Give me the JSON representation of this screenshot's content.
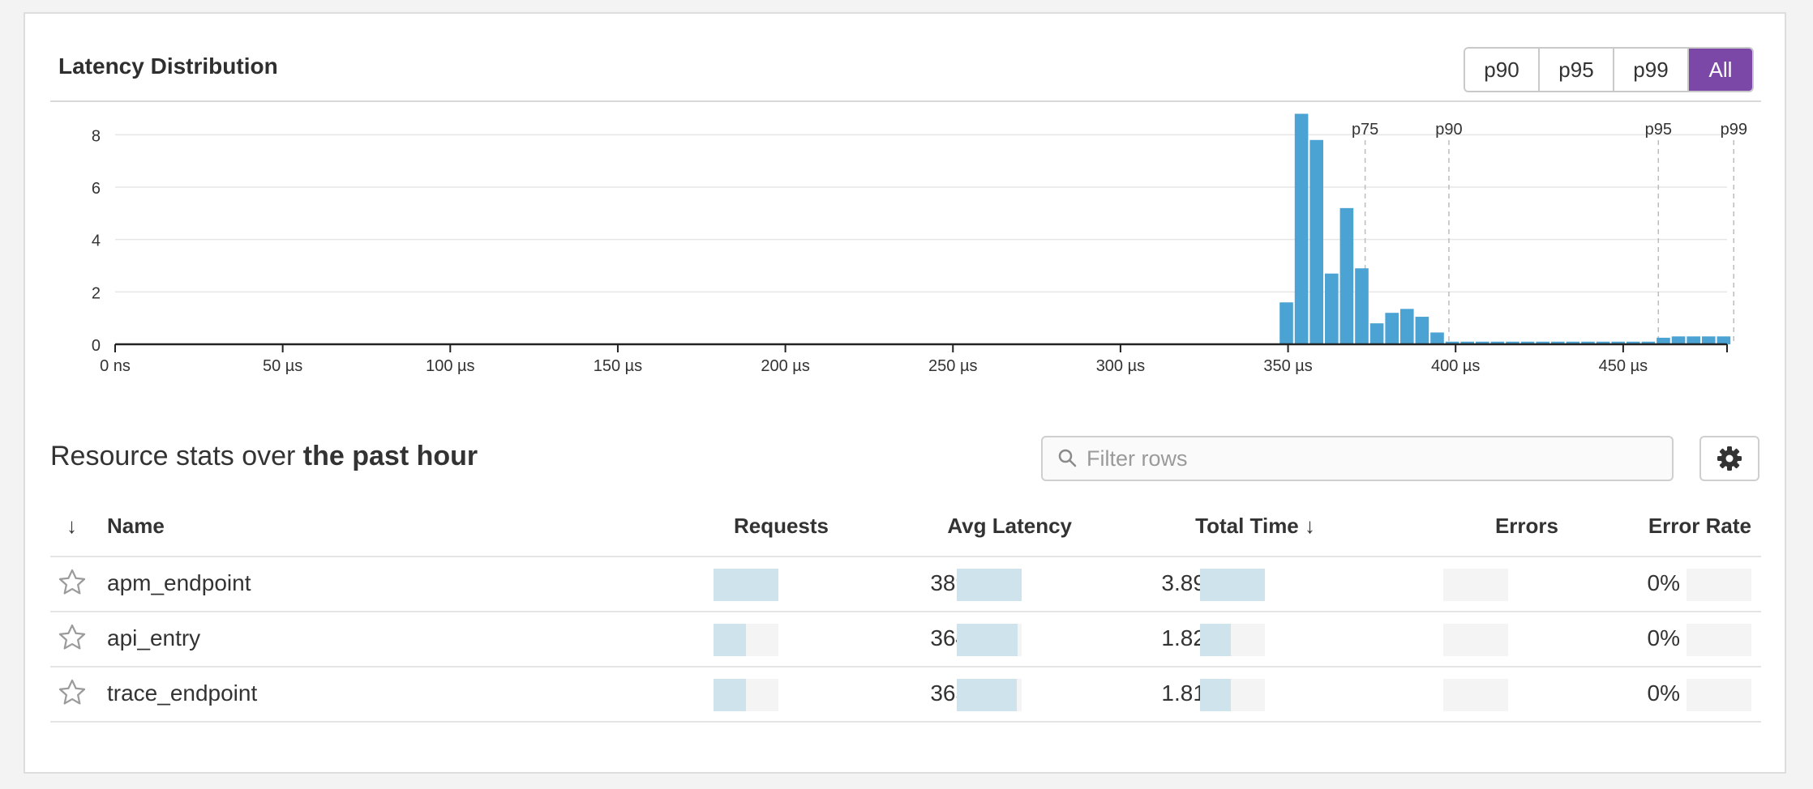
{
  "latency": {
    "title": "Latency Distribution",
    "percentile_buttons": [
      "p90",
      "p95",
      "p99",
      "All"
    ],
    "active_button": "All"
  },
  "chart_data": {
    "type": "bar",
    "title": "",
    "x_ticks": [
      "0 ns",
      "50 µs",
      "100 µs",
      "150 µs",
      "200 µs",
      "250 µs",
      "300 µs",
      "350 µs",
      "400 µs",
      "450 µs"
    ],
    "x_tick_values": [
      0,
      50,
      100,
      150,
      200,
      250,
      300,
      350,
      400,
      450
    ],
    "xlim": [
      0,
      481
    ],
    "y_ticks": [
      0,
      2,
      4,
      6,
      8
    ],
    "ylim": [
      0,
      9
    ],
    "grid": true,
    "bar_color": "#4aa3d3",
    "bins": [
      {
        "x": 349.5,
        "y": 1.6
      },
      {
        "x": 354.0,
        "y": 8.8
      },
      {
        "x": 358.5,
        "y": 7.8
      },
      {
        "x": 363.0,
        "y": 2.7
      },
      {
        "x": 367.5,
        "y": 5.2
      },
      {
        "x": 372.0,
        "y": 2.9
      },
      {
        "x": 376.5,
        "y": 0.8
      },
      {
        "x": 381.0,
        "y": 1.2
      },
      {
        "x": 385.5,
        "y": 1.35
      },
      {
        "x": 390.0,
        "y": 1.05
      },
      {
        "x": 394.5,
        "y": 0.45
      },
      {
        "x": 399.0,
        "y": 0.1
      },
      {
        "x": 403.5,
        "y": 0.1
      },
      {
        "x": 408.0,
        "y": 0.1
      },
      {
        "x": 412.5,
        "y": 0.1
      },
      {
        "x": 417.0,
        "y": 0.1
      },
      {
        "x": 421.5,
        "y": 0.1
      },
      {
        "x": 426.0,
        "y": 0.1
      },
      {
        "x": 430.5,
        "y": 0.1
      },
      {
        "x": 435.0,
        "y": 0.1
      },
      {
        "x": 439.5,
        "y": 0.1
      },
      {
        "x": 444.0,
        "y": 0.1
      },
      {
        "x": 448.5,
        "y": 0.1
      },
      {
        "x": 453.0,
        "y": 0.1
      },
      {
        "x": 457.5,
        "y": 0.1
      },
      {
        "x": 462.0,
        "y": 0.25
      },
      {
        "x": 466.5,
        "y": 0.3
      },
      {
        "x": 471.0,
        "y": 0.3
      },
      {
        "x": 475.5,
        "y": 0.3
      },
      {
        "x": 480.0,
        "y": 0.3
      }
    ],
    "bin_width": 4.5,
    "percentile_markers": [
      {
        "label": "p75",
        "x": 373
      },
      {
        "label": "p90",
        "x": 398
      },
      {
        "label": "p95",
        "x": 460.5
      },
      {
        "label": "p99",
        "x": 483
      }
    ]
  },
  "stats": {
    "heading_prefix": "Resource stats over ",
    "heading_bold": "the past hour",
    "filter_placeholder": "Filter rows",
    "columns": {
      "sort": "↓",
      "name": "Name",
      "requests": "Requests",
      "avg_latency": "Avg Latency",
      "total_time": "Total Time ↓",
      "errors": "Errors",
      "error_rate": "Error Rate"
    },
    "rows": [
      {
        "name": "apm_endpoint",
        "requests": "10",
        "requests_fill": 1.0,
        "avg_latency": "389 µs",
        "avg_latency_fill": 1.0,
        "total_time": "3.89 ms",
        "total_time_fill": 1.0,
        "errors": "0",
        "errors_fill": 0,
        "error_rate": "0%",
        "error_rate_fill": 0
      },
      {
        "name": "api_entry",
        "requests": "5",
        "requests_fill": 0.5,
        "avg_latency": "364 µs",
        "avg_latency_fill": 0.94,
        "total_time": "1.82 ms",
        "total_time_fill": 0.47,
        "errors": "0",
        "errors_fill": 0,
        "error_rate": "0%",
        "error_rate_fill": 0
      },
      {
        "name": "trace_endpoint",
        "requests": "5",
        "requests_fill": 0.5,
        "avg_latency": "363 µs",
        "avg_latency_fill": 0.93,
        "total_time": "1.81 ms",
        "total_time_fill": 0.47,
        "errors": "0",
        "errors_fill": 0,
        "error_rate": "0%",
        "error_rate_fill": 0
      }
    ]
  }
}
